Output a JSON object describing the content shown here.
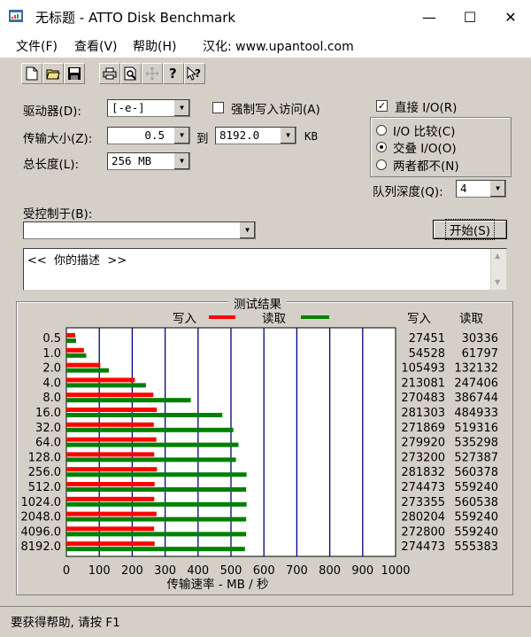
{
  "window": {
    "title": "无标题 - ATTO Disk Benchmark",
    "minimize": "—",
    "maximize": "☐",
    "close": "✕"
  },
  "menu": {
    "file": "文件(F)",
    "view": "查看(V)",
    "help": "帮助(H)",
    "localized": "汉化: www.upantool.com"
  },
  "toolbar": {
    "icons": [
      "new-file-icon",
      "open-folder-icon",
      "save-icon",
      "print-icon",
      "print-preview-icon",
      "move-icon",
      "help-icon",
      "context-help-icon"
    ]
  },
  "form": {
    "drive_label": "驱动器(D):",
    "drive_value": "[-e-]",
    "force_write_label": "强制写入访问(A)",
    "force_write_checked": false,
    "transfer_label": "传输大小(Z):",
    "transfer_from": "0.5",
    "transfer_to_label": "到",
    "transfer_to": "8192.0",
    "transfer_unit": "KB",
    "total_label": "总长度(L):",
    "total_value": "256 MB",
    "direct_io_label": "直接 I/O(R)",
    "direct_io_checked": true,
    "io_compare_label": "I/O 比较(C)",
    "overlap_io_label": "交叠 I/O(O)",
    "neither_label": "两者都不(N)",
    "selected_mode": "overlap",
    "queue_label": "队列深度(Q):",
    "queue_value": "4",
    "controlled_by_label": "受控制于(B):",
    "controlled_by_value": "",
    "start_label": "开始(S)",
    "description_text": "<<  你的描述  >>"
  },
  "results": {
    "title": "测试结果",
    "legend_write": "写入",
    "legend_read": "读取",
    "col_write": "写入",
    "col_read": "读取",
    "write_color": "#ff0000",
    "read_color": "#008000"
  },
  "chart_data": {
    "type": "bar",
    "orientation": "horizontal",
    "categories": [
      "0.5",
      "1.0",
      "2.0",
      "4.0",
      "8.0",
      "16.0",
      "32.0",
      "64.0",
      "128.0",
      "256.0",
      "512.0",
      "1024.0",
      "2048.0",
      "4096.0",
      "8192.0"
    ],
    "series": [
      {
        "name": "写入",
        "values": [
          27451,
          54528,
          105493,
          213081,
          270483,
          281303,
          271869,
          279920,
          273200,
          281832,
          274473,
          273355,
          280204,
          272800,
          274473
        ]
      },
      {
        "name": "读取",
        "values": [
          30336,
          61797,
          132132,
          247406,
          386744,
          484933,
          519316,
          535298,
          527387,
          560378,
          559240,
          560538,
          559240,
          559240,
          555383
        ]
      }
    ],
    "xticks": [
      "0",
      "100",
      "200",
      "300",
      "400",
      "500",
      "600",
      "700",
      "800",
      "900",
      "1000"
    ],
    "xlabel": "传输速率 - MB / 秒",
    "xlim": [
      0,
      1000
    ],
    "grid": true
  },
  "status": {
    "text": "要获得帮助, 请按 F1"
  }
}
